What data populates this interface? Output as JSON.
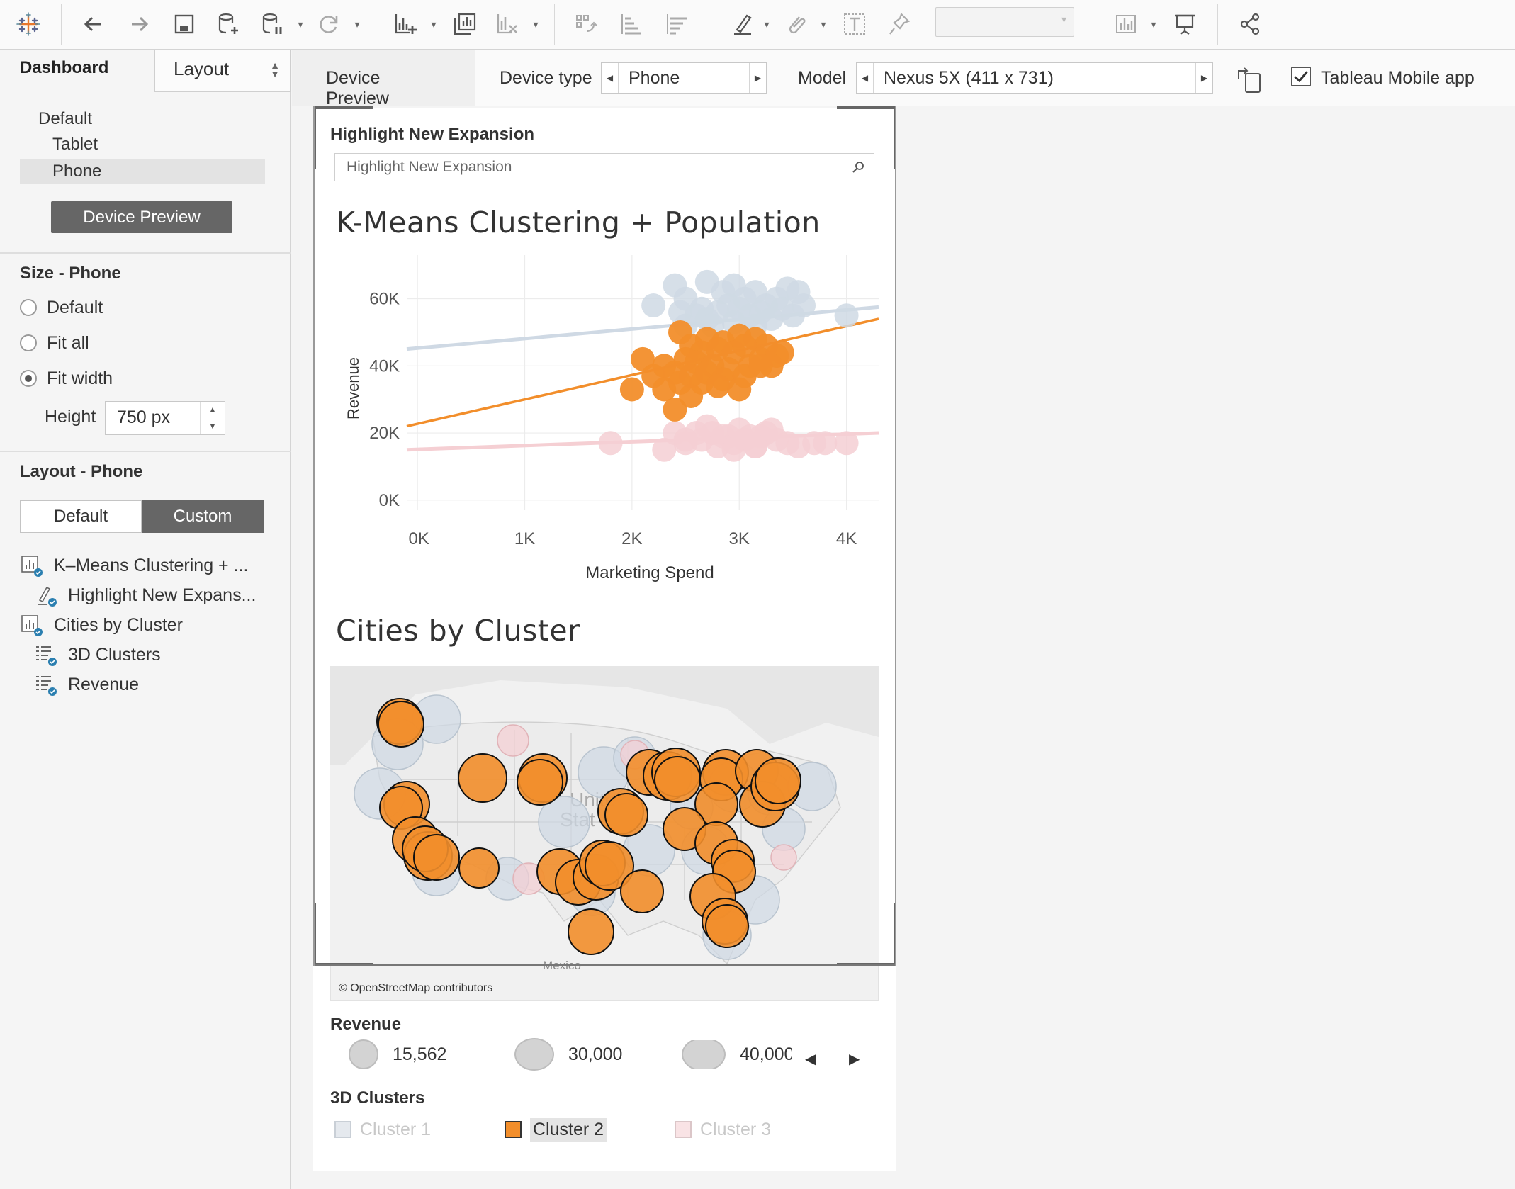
{
  "toolbar": {
    "icons": [
      "tableau-logo-icon",
      "back-icon",
      "forward-icon",
      "save-icon",
      "new-datasource-icon",
      "pause-updates-icon",
      "refresh-icon",
      "new-worksheet-icon",
      "duplicate-icon",
      "clear-icon",
      "swap-icon",
      "sort-ascending-icon",
      "sort-descending-icon",
      "highlight-icon",
      "group-icon",
      "show-labels-icon",
      "fix-axes-icon",
      "show-me-icon",
      "presentation-icon",
      "share-icon"
    ],
    "combo_value": ""
  },
  "sidebar": {
    "tab_dashboard": "Dashboard",
    "tab_layout": "Layout",
    "devices": [
      "Default",
      "Tablet",
      "Phone"
    ],
    "selected_device": "Phone",
    "device_preview_button": "Device Preview",
    "size_title": "Size - Phone",
    "size_options": [
      "Default",
      "Fit all",
      "Fit width"
    ],
    "size_selected": "Fit width",
    "height_label": "Height",
    "height_value": "750 px",
    "layout_title": "Layout - Phone",
    "layout_default": "Default",
    "layout_custom": "Custom",
    "tree": [
      {
        "label": "K–Means Clustering + ...",
        "icon": "worksheet-icon"
      },
      {
        "label": "Highlight New Expans...",
        "icon": "highlighter-icon"
      },
      {
        "label": "Cities by Cluster",
        "icon": "worksheet-icon"
      },
      {
        "label": "3D Clusters",
        "icon": "legend-icon"
      },
      {
        "label": "Revenue",
        "icon": "legend-icon"
      }
    ]
  },
  "device_bar": {
    "tab": "Device Preview",
    "device_type_label": "Device type",
    "device_type_value": "Phone",
    "model_label": "Model",
    "model_value": "Nexus 5X (411 x 731)",
    "mobile_app_label": "Tableau Mobile app",
    "mobile_app_checked": true
  },
  "dashboard": {
    "filter_title": "Highlight New Expansion",
    "filter_placeholder": "Highlight New Expansion",
    "chart1_title": "K-Means Clustering + Population",
    "chart2_title": "Cities by Cluster",
    "map_credit": "© OpenStreetMap contributors",
    "map_labels": [
      "Unite",
      "Stat",
      "Mexico"
    ],
    "legend_revenue_title": "Revenue",
    "legend_revenue_items": [
      "15,562",
      "30,000",
      "40,000"
    ],
    "legend_clusters_title": "3D Clusters",
    "legend_clusters": [
      "Cluster 1",
      "Cluster 2",
      "Cluster 3"
    ],
    "colors": {
      "cluster1": "#cfd9e4",
      "cluster2": "#f28e2b",
      "cluster3": "#f5cfd3"
    }
  },
  "chart_data": {
    "type": "scatter",
    "title": "K-Means Clustering + Population",
    "xlabel": "Marketing Spend",
    "ylabel": "Revenue",
    "xlim": [
      -100,
      4300
    ],
    "ylim": [
      -3000,
      73000
    ],
    "x_ticks": [
      "0K",
      "1K",
      "2K",
      "3K",
      "4K"
    ],
    "y_ticks": [
      "0K",
      "20K",
      "40K",
      "60K"
    ],
    "series": [
      {
        "name": "Cluster 1",
        "color": "#cfd9e4",
        "x": [
          2200,
          2500,
          2400,
          2700,
          2850,
          2950,
          3050,
          3150,
          3250,
          3350,
          3450,
          3550,
          2600,
          2800,
          2900,
          3000,
          3100,
          3200,
          3400,
          2500,
          2700,
          2950,
          3150,
          3300,
          3500,
          3600,
          4000,
          2450,
          2650,
          2750
        ],
        "y": [
          58000,
          60000,
          64000,
          65000,
          62000,
          64000,
          60000,
          62000,
          58000,
          60000,
          63000,
          62000,
          55000,
          56000,
          58000,
          57000,
          55000,
          56000,
          57000,
          52000,
          54000,
          53000,
          52000,
          54000,
          55000,
          58000,
          55000,
          56000,
          57000,
          52000
        ],
        "trend": [
          [
            -100,
            45000
          ],
          [
            4300,
            57500
          ]
        ]
      },
      {
        "name": "Cluster 2",
        "color": "#f28e2b",
        "x": [
          2450,
          2550,
          2700,
          2850,
          3000,
          3150,
          3250,
          3400,
          2650,
          2800,
          2950,
          3050,
          3200,
          3350,
          2100,
          2300,
          2500,
          2600,
          2750,
          2900,
          3100,
          3300,
          2200,
          2400,
          2550,
          2700,
          2850,
          3050,
          3200,
          2000,
          2300,
          2450,
          2650,
          2800,
          3000,
          2550,
          2400
        ],
        "y": [
          50000,
          46000,
          48000,
          47000,
          49000,
          48000,
          46000,
          44000,
          44000,
          45000,
          44000,
          46000,
          42000,
          43000,
          42000,
          40000,
          42000,
          41000,
          40000,
          39000,
          40000,
          40000,
          37000,
          38000,
          37000,
          38000,
          36000,
          37000,
          40000,
          33000,
          33000,
          35000,
          35000,
          34000,
          33000,
          31000,
          27000
        ],
        "trend": [
          [
            -100,
            22000
          ],
          [
            4300,
            54000
          ]
        ]
      },
      {
        "name": "Cluster 3",
        "color": "#f5cfd3",
        "x": [
          1800,
          2300,
          2500,
          2650,
          2750,
          2850,
          2950,
          3050,
          3150,
          3250,
          3350,
          3450,
          3550,
          3700,
          3800,
          4000,
          2400,
          2600,
          2700,
          2900,
          3000,
          3100,
          3200,
          3300,
          2500,
          2800,
          2950,
          3150
        ],
        "y": [
          17000,
          15000,
          17000,
          18000,
          20000,
          19000,
          17000,
          18000,
          16000,
          20000,
          18000,
          17000,
          16000,
          17000,
          17000,
          17000,
          20000,
          20000,
          22000,
          19000,
          21000,
          19000,
          19000,
          21000,
          18000,
          16000,
          15000,
          16000
        ],
        "trend": [
          [
            -100,
            15000
          ],
          [
            4300,
            20000
          ]
        ]
      }
    ]
  }
}
